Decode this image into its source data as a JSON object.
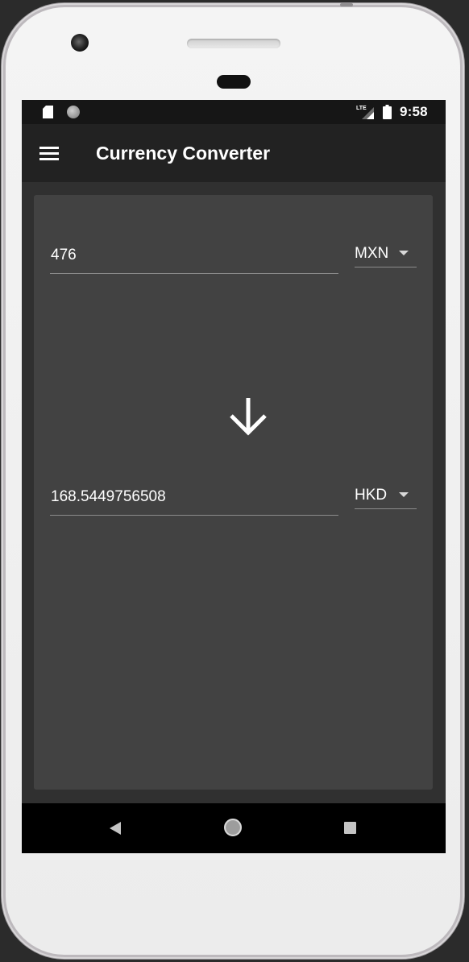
{
  "status_bar": {
    "time": "9:58",
    "network_label": "LTE",
    "icons": [
      "sd-card-icon",
      "sync-icon",
      "lte-signal-icon",
      "battery-icon"
    ]
  },
  "app_bar": {
    "title": "Currency Converter",
    "menu_icon": "hamburger-menu-icon"
  },
  "converter": {
    "from": {
      "amount": "476",
      "currency": "MXN"
    },
    "direction_icon": "arrow-down-icon",
    "to": {
      "amount": "168.5449756508",
      "currency": "HKD"
    }
  },
  "nav_bar": {
    "icons": [
      "back-icon",
      "home-icon",
      "recents-icon"
    ]
  },
  "colors": {
    "screen_background": "#303030",
    "card_background": "#424242",
    "app_bar_background": "#222222",
    "status_bar_background": "#161616",
    "nav_bar_background": "#000000",
    "text": "#ffffff",
    "underline": "#8c8c8c"
  }
}
